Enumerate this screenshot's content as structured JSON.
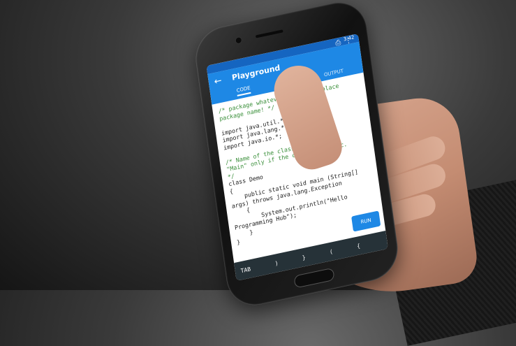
{
  "status": {
    "time": "3:42"
  },
  "app": {
    "title": "Playground",
    "tabs": [
      "CODE",
      "OUTPUT"
    ],
    "run_label": "RUN",
    "keys": [
      "TAB",
      ")",
      "}",
      "(",
      "{"
    ]
  },
  "code_lines": [
    "/* package whatever; // don't place",
    "package name! */",
    "",
    "import java.util.*;",
    "import java.lang.*;",
    "import java.io.*;",
    "",
    "/* Name of the class has to be",
    "\"Main\" only if the class is public.",
    "*/",
    "class Demo",
    "{",
    "    public static void main (String[]",
    "args) throws java.lang.Exception",
    "    {",
    "        System.out.println(\"Hello",
    "Programming Hub\");",
    "    }",
    "}"
  ],
  "colors": {
    "primary": "#1e88e5",
    "primary_dark": "#1565c0",
    "bottom_bar": "#263238"
  }
}
